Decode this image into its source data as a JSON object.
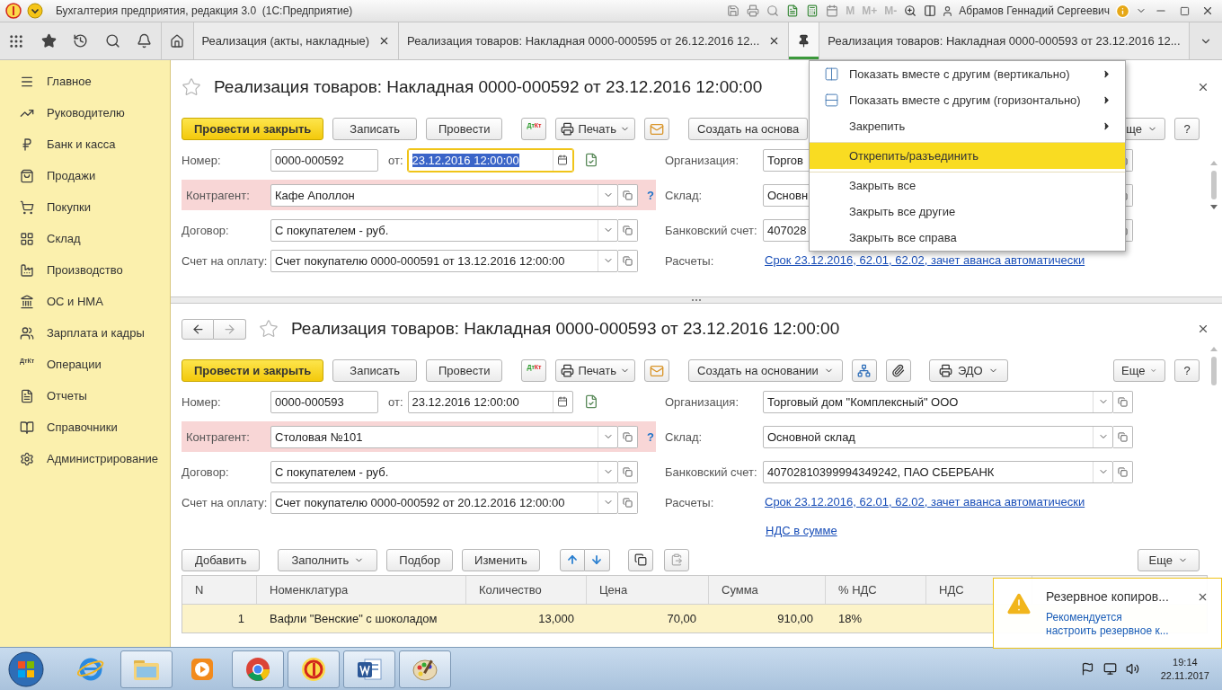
{
  "title_bar": {
    "title": "Бухгалтерия предприятия, редакция 3.0  (1С:Предприятие)",
    "memory_buttons": [
      "M",
      "M+",
      "M-"
    ],
    "user": "Абрамов Геннадий Сергеевич"
  },
  "tabs": [
    {
      "kind": "tab",
      "label": "Реализация (акты, накладные)",
      "selected": false,
      "closable": true
    },
    {
      "kind": "tab",
      "label": "Реализация товаров: Накладная 0000-000595 от 26.12.2016 12...",
      "selected": false,
      "closable": true
    },
    {
      "kind": "pin",
      "selected": true
    },
    {
      "kind": "tab",
      "label": "Реализация товаров: Накладная 0000-000593 от 23.12.2016 12...",
      "selected": false,
      "closable": false
    }
  ],
  "sidebar": {
    "items": [
      {
        "label": "Главное"
      },
      {
        "label": "Руководителю"
      },
      {
        "label": "Банк и касса"
      },
      {
        "label": "Продажи"
      },
      {
        "label": "Покупки"
      },
      {
        "label": "Склад"
      },
      {
        "label": "Производство"
      },
      {
        "label": "ОС и НМА"
      },
      {
        "label": "Зарплата и кадры"
      },
      {
        "label": "Операции",
        "icon_text": [
          "Дт",
          "Кт"
        ]
      },
      {
        "label": "Отчеты"
      },
      {
        "label": "Справочники"
      },
      {
        "label": "Администрирование"
      }
    ]
  },
  "documents": [
    {
      "title": "Реализация товаров: Накладная 0000-000592 от 23.12.2016 12:00:00",
      "history_buttons": false,
      "toolbar": {
        "post_close": "Провести и закрыть",
        "save": "Записать",
        "post": "Провести",
        "dtkt": [
          "Дт",
          "Кт"
        ],
        "print": "Печать",
        "create_based": "Создать на основа",
        "more": "ще",
        "help": "?"
      },
      "number": {
        "label": "Номер:",
        "value": "0000-000592"
      },
      "date": {
        "label": "от:",
        "value": "23.12.2016 12:00:00",
        "focused": true
      },
      "left_fields": [
        {
          "label": "Контрагент:",
          "value": "Кафе Аполлон",
          "highlighted": true,
          "hint": "?"
        },
        {
          "label": "Договор:",
          "value": "С покупателем - руб.",
          "highlighted": false
        },
        {
          "label": "Счет на оплату:",
          "value": "Счет покупателю 0000-000591 от 13.12.2016 12:00:00",
          "highlighted": false
        }
      ],
      "right_fields": [
        {
          "label": "Организация:",
          "value": "Торгов"
        },
        {
          "label": "Склад:",
          "value": "Основн"
        },
        {
          "label": "Банковский счет:",
          "value": "407028"
        }
      ],
      "settlements": {
        "label": "Расчеты:",
        "link": "Срок 23.12.2016, 62.01, 62.02, зачет аванса автоматически"
      }
    },
    {
      "title": "Реализация товаров: Накладная 0000-000593 от 23.12.2016 12:00:00",
      "history_buttons": true,
      "toolbar": {
        "post_close": "Провести и закрыть",
        "save": "Записать",
        "post": "Провести",
        "dtkt": [
          "Дт",
          "Кт"
        ],
        "print": "Печать",
        "create_based": "Создать на основании",
        "create_based_menu": true,
        "icon_buttons": true,
        "edo": "ЭДО",
        "more": "Еще",
        "help": "?"
      },
      "number": {
        "label": "Номер:",
        "value": "0000-000593"
      },
      "date": {
        "label": "от:",
        "value": "23.12.2016 12:00:00",
        "focused": false
      },
      "left_fields": [
        {
          "label": "Контрагент:",
          "value": "Столовая №101",
          "highlighted": true,
          "hint": "?"
        },
        {
          "label": "Договор:",
          "value": "С покупателем - руб.",
          "highlighted": false
        },
        {
          "label": "Счет на оплату:",
          "value": "Счет покупателю 0000-000592 от 20.12.2016 12:00:00",
          "highlighted": false
        }
      ],
      "right_fields": [
        {
          "label": "Организация:",
          "value": "Торговый дом \"Комплексный\" ООО",
          "dropdown": true
        },
        {
          "label": "Склад:",
          "value": "Основной склад",
          "dropdown": true
        },
        {
          "label": "Банковский счет:",
          "value": "40702810399994349242, ПАО СБЕРБАНК",
          "dropdown": true
        }
      ],
      "settlements": {
        "label": "Расчеты:",
        "link": "Срок 23.12.2016, 62.01, 62.02, зачет аванса автоматически"
      },
      "vat_link": "НДС в сумме",
      "table": {
        "toolbar": {
          "add": "Добавить",
          "fill": "Заполнить",
          "pick": "Подбор",
          "edit": "Изменить",
          "more": "Еще"
        },
        "columns": [
          "N",
          "Номенклатура",
          "Количество",
          "Цена",
          "Сумма",
          "% НДС",
          "НДС"
        ],
        "rows": [
          {
            "cells": [
              "1",
              "Вафли \"Венские\" с шоколадом",
              "13,000",
              "70,00",
              "910,00",
              "18%"
            ],
            "selected": true
          }
        ]
      }
    }
  ],
  "menu": {
    "items": [
      {
        "label": "Показать вместе с другим (вертикально)",
        "submenu": true,
        "selected": false
      },
      {
        "label": "Показать вместе с другим (горизонтально)",
        "submenu": true,
        "selected": false
      },
      {
        "label": "Закрепить",
        "submenu": true,
        "selected": false
      },
      {
        "label": "Открепить/разъединить",
        "submenu": false,
        "selected": true,
        "separated": true
      },
      {
        "label": "Закрыть все",
        "submenu": false,
        "selected": false,
        "separated": true
      },
      {
        "label": "Закрыть все другие",
        "submenu": false,
        "selected": false
      },
      {
        "label": "Закрыть все справа",
        "submenu": false,
        "selected": false
      }
    ]
  },
  "notification": {
    "title": "Резервное копиров...",
    "text": "Рекомендуется настроить резервное к..."
  },
  "taskbar": {
    "time": "19:14",
    "date": "22.11.2017"
  }
}
